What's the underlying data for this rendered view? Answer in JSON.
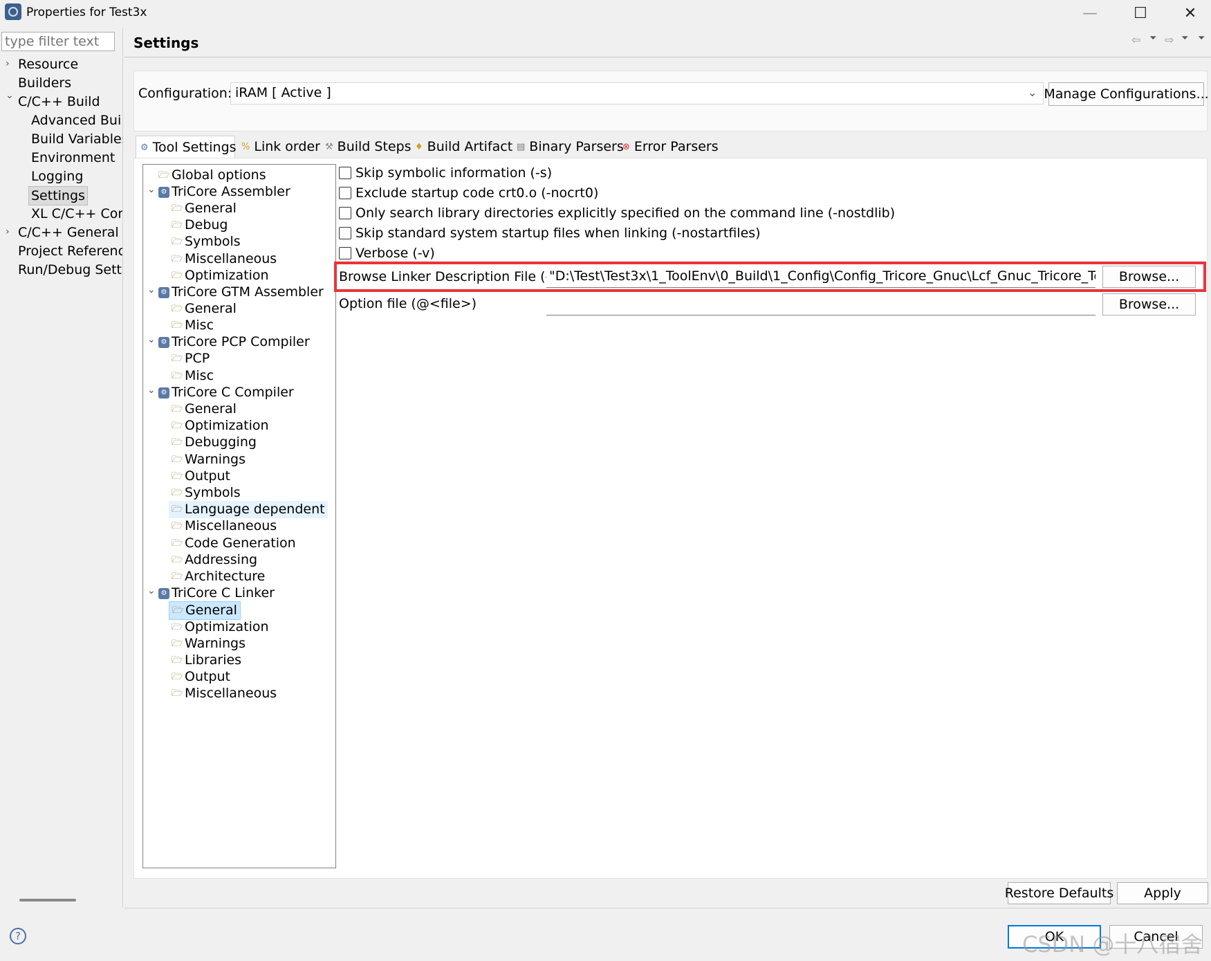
{
  "window": {
    "title": "Properties for Test3x",
    "minimize_label": "—",
    "maximize_label": "☐",
    "close_label": "✕"
  },
  "left_nav": {
    "filter_placeholder": "type filter text",
    "items": [
      {
        "label": "Resource",
        "expand": "›"
      },
      {
        "label": "Builders"
      },
      {
        "label": "C/C++ Build",
        "expand": "⌄"
      },
      {
        "label": "Advanced Buil"
      },
      {
        "label": "Build Variables"
      },
      {
        "label": "Environment"
      },
      {
        "label": "Logging"
      },
      {
        "label": "Settings"
      },
      {
        "label": "XL C/C++ Com"
      },
      {
        "label": "C/C++ General",
        "expand": "›"
      },
      {
        "label": "Project Reference"
      },
      {
        "label": "Run/Debug Setti"
      }
    ]
  },
  "header": {
    "title": "Settings",
    "nav_back": "⇦",
    "nav_forward": "⇨",
    "menu": "⏷"
  },
  "configuration": {
    "label": "Configuration:",
    "value": "iRAM  [ Active ]",
    "manage_button": "Manage Configurations..."
  },
  "tabs": [
    {
      "label": "Tool Settings",
      "icon": "tool-settings-icon"
    },
    {
      "label": "Link order",
      "icon": "link-order-icon"
    },
    {
      "label": "Build Steps",
      "icon": "build-steps-icon"
    },
    {
      "label": "Build Artifact",
      "icon": "build-artifact-icon"
    },
    {
      "label": "Binary Parsers",
      "icon": "binary-parsers-icon"
    },
    {
      "label": "Error Parsers",
      "icon": "error-parsers-icon"
    }
  ],
  "tree": {
    "items": [
      {
        "label": "Global options"
      },
      {
        "label": "TriCore Assembler"
      },
      {
        "label": "General"
      },
      {
        "label": "Debug"
      },
      {
        "label": "Symbols"
      },
      {
        "label": "Miscellaneous"
      },
      {
        "label": "Optimization"
      },
      {
        "label": "TriCore GTM Assembler"
      },
      {
        "label": "General"
      },
      {
        "label": "Misc"
      },
      {
        "label": "TriCore PCP Compiler"
      },
      {
        "label": "PCP"
      },
      {
        "label": "Misc"
      },
      {
        "label": "TriCore C Compiler"
      },
      {
        "label": "General"
      },
      {
        "label": "Optimization"
      },
      {
        "label": "Debugging"
      },
      {
        "label": "Warnings"
      },
      {
        "label": "Output"
      },
      {
        "label": "Symbols"
      },
      {
        "label": "Language dependent"
      },
      {
        "label": "Miscellaneous"
      },
      {
        "label": "Code Generation"
      },
      {
        "label": "Addressing"
      },
      {
        "label": "Architecture"
      },
      {
        "label": "TriCore C Linker"
      },
      {
        "label": "General"
      },
      {
        "label": "Optimization"
      },
      {
        "label": "Warnings"
      },
      {
        "label": "Libraries"
      },
      {
        "label": "Output"
      },
      {
        "label": "Miscellaneous"
      }
    ]
  },
  "options": {
    "checkboxes": [
      {
        "label": "Skip symbolic information (-s)",
        "checked": false
      },
      {
        "label": "Exclude startup code crt0.o (-nocrt0)",
        "checked": false
      },
      {
        "label": "Only search library directories explicitly specified on the command line (-nostdlib)",
        "checked": false
      },
      {
        "label": "Skip standard system startup files when linking (-nostartfiles)",
        "checked": false
      },
      {
        "label": "Verbose (-v)",
        "checked": false
      }
    ],
    "linker_file": {
      "label": "Browse Linker Description File (-T)",
      "value": "\"D:\\Test\\Test3x\\1_ToolEnv\\0_Build\\1_Config\\Config_Tricore_Gnuc\\Lcf_Gnuc_Tricore_Tc.lsl\"",
      "browse": "Browse..."
    },
    "option_file": {
      "label": "Option file (@<file>)",
      "value": "",
      "browse": "Browse..."
    }
  },
  "footer": {
    "restore_defaults": "Restore Defaults",
    "apply": "Apply",
    "ok": "OK",
    "cancel": "Cancel",
    "help": "?",
    "watermark": "CSDN @十八宿舍"
  },
  "colors": {
    "highlight_box": "#e8343a",
    "selection": "#cce8ff"
  }
}
